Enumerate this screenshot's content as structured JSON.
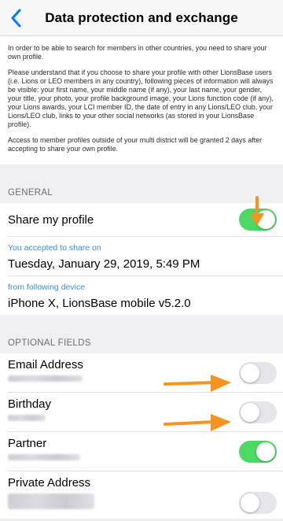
{
  "nav": {
    "back_icon": "chevron-left-icon",
    "title": "Data protection and exchange"
  },
  "intro": {
    "p1": "In order to be able to search for members in other countries, you need to share your own profile.",
    "p2": "Please understand that if you choose to share your profile with other LionsBase users (i.e. Lions or LEO members in any country), following pieces of information will always be visible: your first name, your middle name (if any), your last name, your gender, your title, your photo, your profile background image, your Lions function code (if any), your Lions awards, your LCI member ID, the date of entry in any Lions/LEO club, your Lions/LEO club, links to your other social networks (as stored in your LionsBase profile).",
    "p3": "Access to member profiles outside of your multi district will be granted 2 days after accepting to share your own profile."
  },
  "general": {
    "header": "GENERAL",
    "share_label": "Share my profile",
    "share_on": true,
    "accepted_label": "You accepted to share on",
    "accepted_value": "Tuesday, January 29, 2019, 5:49 PM",
    "device_label": "from following device",
    "device_value": "iPhone X, LionsBase mobile v5.2.0"
  },
  "optional": {
    "header": "OPTIONAL FIELDS",
    "fields": [
      {
        "label": "Email Address",
        "on": false
      },
      {
        "label": "Birthday",
        "on": false
      },
      {
        "label": "Partner",
        "on": true
      },
      {
        "label": "Private Address",
        "on": false
      }
    ]
  },
  "colors": {
    "accent": "#007aff",
    "toggle_on": "#4cd964",
    "arrow": "#f7931e"
  }
}
